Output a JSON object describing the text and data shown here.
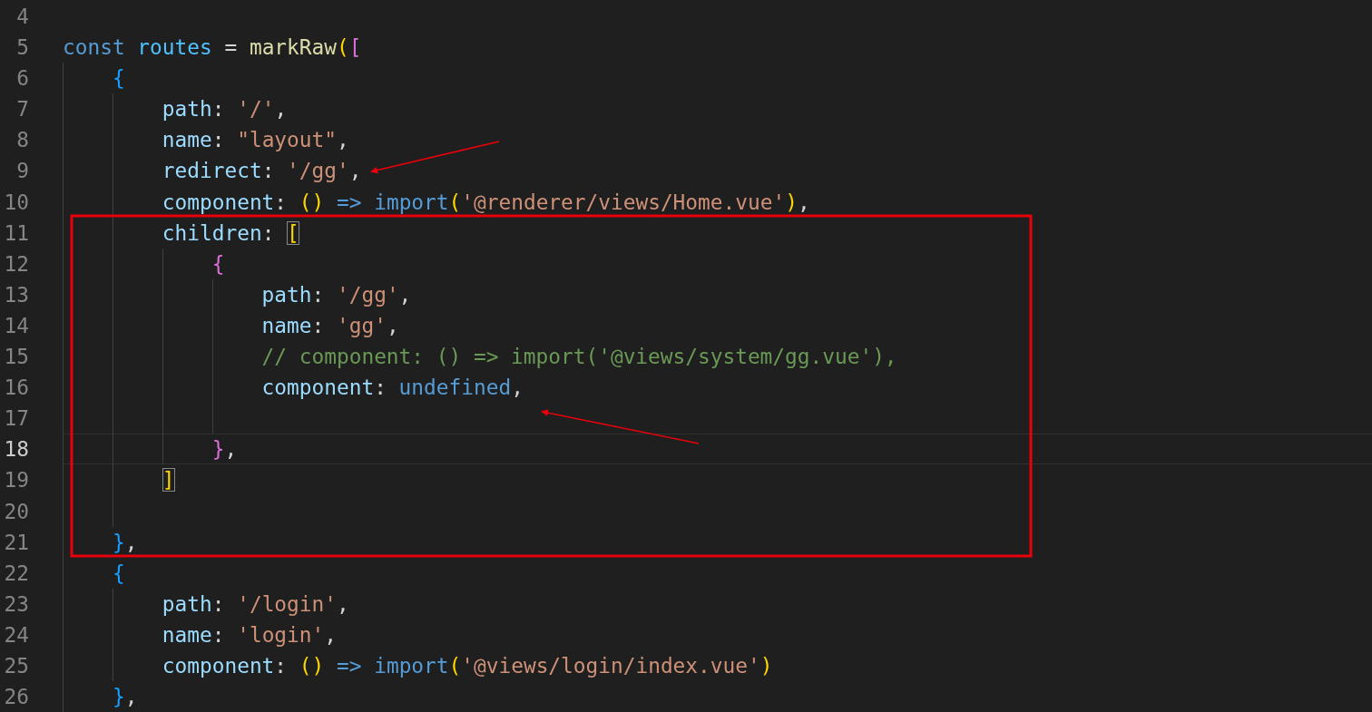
{
  "editor": {
    "lines": [
      {
        "number": "4",
        "current": false
      },
      {
        "number": "5",
        "current": false,
        "tokens": [
          {
            "kind": "kw",
            "text": "const "
          },
          {
            "kind": "var",
            "text": "routes"
          },
          {
            "kind": "p",
            "text": " = "
          },
          {
            "kind": "fn",
            "text": "markRaw"
          },
          {
            "kind": "b1",
            "text": "("
          },
          {
            "kind": "b2",
            "text": "["
          }
        ]
      },
      {
        "number": "6",
        "current": false,
        "tokens": [
          {
            "kind": "b3",
            "text": "    {"
          }
        ]
      },
      {
        "number": "7",
        "current": false,
        "tokens": [
          {
            "kind": "prop",
            "text": "        path"
          },
          {
            "kind": "p",
            "text": ": "
          },
          {
            "kind": "str",
            "text": "'/'"
          },
          {
            "kind": "p",
            "text": ","
          }
        ]
      },
      {
        "number": "8",
        "current": false,
        "tokens": [
          {
            "kind": "prop",
            "text": "        name"
          },
          {
            "kind": "p",
            "text": ": "
          },
          {
            "kind": "str",
            "text": "\"layout\""
          },
          {
            "kind": "p",
            "text": ","
          }
        ]
      },
      {
        "number": "9",
        "current": false,
        "tokens": [
          {
            "kind": "prop",
            "text": "        redirect"
          },
          {
            "kind": "p",
            "text": ": "
          },
          {
            "kind": "str",
            "text": "'/gg'"
          },
          {
            "kind": "p",
            "text": ","
          }
        ]
      },
      {
        "number": "10",
        "current": false,
        "tokens": [
          {
            "kind": "prop",
            "text": "        component"
          },
          {
            "kind": "p",
            "text": ": "
          },
          {
            "kind": "b1",
            "text": "() "
          },
          {
            "kind": "kw",
            "text": "=> "
          },
          {
            "kind": "kw",
            "text": "import"
          },
          {
            "kind": "b1",
            "text": "("
          },
          {
            "kind": "str",
            "text": "'@renderer/views/Home.vue'"
          },
          {
            "kind": "b1",
            "text": ")"
          },
          {
            "kind": "p",
            "text": ","
          }
        ]
      },
      {
        "number": "11",
        "current": false,
        "tokens": [
          {
            "kind": "prop",
            "text": "        children"
          },
          {
            "kind": "p",
            "text": ": "
          },
          {
            "kind": "b1-match",
            "text": "["
          }
        ]
      },
      {
        "number": "12",
        "current": false,
        "tokens": [
          {
            "kind": "b2",
            "text": "            {"
          }
        ]
      },
      {
        "number": "13",
        "current": false,
        "tokens": [
          {
            "kind": "prop",
            "text": "                path"
          },
          {
            "kind": "p",
            "text": ": "
          },
          {
            "kind": "str",
            "text": "'/gg'"
          },
          {
            "kind": "p",
            "text": ","
          }
        ]
      },
      {
        "number": "14",
        "current": false,
        "tokens": [
          {
            "kind": "prop",
            "text": "                name"
          },
          {
            "kind": "p",
            "text": ": "
          },
          {
            "kind": "str",
            "text": "'gg'"
          },
          {
            "kind": "p",
            "text": ","
          }
        ]
      },
      {
        "number": "15",
        "current": false,
        "tokens": [
          {
            "kind": "cmt",
            "text": "                // component: () => import('@views/system/gg.vue'),"
          }
        ]
      },
      {
        "number": "16",
        "current": false,
        "tokens": [
          {
            "kind": "prop",
            "text": "                component"
          },
          {
            "kind": "p",
            "text": ": "
          },
          {
            "kind": "kw",
            "text": "undefined"
          },
          {
            "kind": "p",
            "text": ","
          }
        ]
      },
      {
        "number": "17",
        "current": false
      },
      {
        "number": "18",
        "current": true,
        "tokens": [
          {
            "kind": "b2",
            "text": "            }"
          },
          {
            "kind": "p",
            "text": ","
          }
        ]
      },
      {
        "number": "19",
        "current": false,
        "tokens": [
          {
            "kind": "b1-match",
            "text": "        ]"
          }
        ]
      },
      {
        "number": "20",
        "current": false
      },
      {
        "number": "21",
        "current": false,
        "tokens": [
          {
            "kind": "b3",
            "text": "    }"
          },
          {
            "kind": "p",
            "text": ","
          }
        ]
      },
      {
        "number": "22",
        "current": false,
        "tokens": [
          {
            "kind": "b3",
            "text": "    {"
          }
        ]
      },
      {
        "number": "23",
        "current": false,
        "tokens": [
          {
            "kind": "prop",
            "text": "        path"
          },
          {
            "kind": "p",
            "text": ": "
          },
          {
            "kind": "str",
            "text": "'/login'"
          },
          {
            "kind": "p",
            "text": ","
          }
        ]
      },
      {
        "number": "24",
        "current": false,
        "tokens": [
          {
            "kind": "prop",
            "text": "        name"
          },
          {
            "kind": "p",
            "text": ": "
          },
          {
            "kind": "str",
            "text": "'login'"
          },
          {
            "kind": "p",
            "text": ","
          }
        ]
      },
      {
        "number": "25",
        "current": false,
        "tokens": [
          {
            "kind": "prop",
            "text": "        component"
          },
          {
            "kind": "p",
            "text": ": "
          },
          {
            "kind": "b1",
            "text": "() "
          },
          {
            "kind": "kw",
            "text": "=> "
          },
          {
            "kind": "kw",
            "text": "import"
          },
          {
            "kind": "b1",
            "text": "("
          },
          {
            "kind": "str",
            "text": "'@views/login/index.vue'"
          },
          {
            "kind": "b1",
            "text": ")"
          }
        ]
      },
      {
        "number": "26",
        "current": false,
        "tokens": [
          {
            "kind": "b3",
            "text": "    }"
          },
          {
            "kind": "p",
            "text": ","
          }
        ]
      }
    ]
  },
  "annotations": [
    {
      "kind": "rectangle"
    },
    {
      "kind": "arrow"
    },
    {
      "kind": "arrow"
    }
  ]
}
